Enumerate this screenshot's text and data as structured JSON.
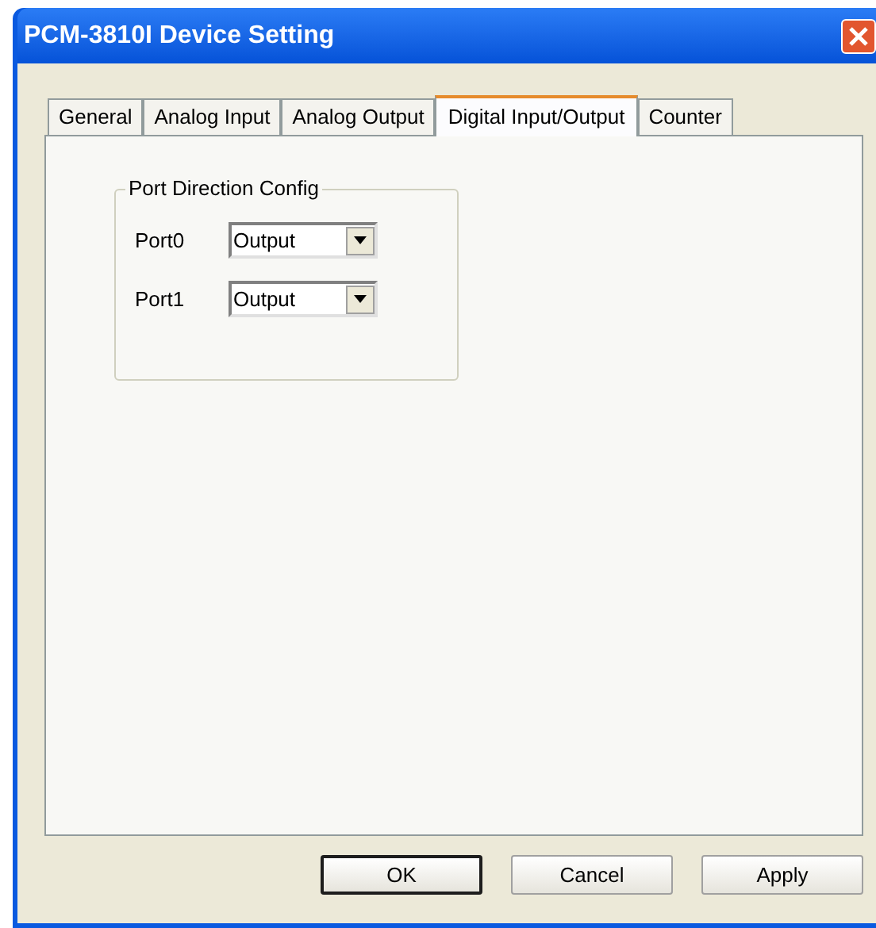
{
  "window": {
    "title": "PCM-3810I Device Setting"
  },
  "tabs": [
    {
      "label": "General",
      "selected": false
    },
    {
      "label": "Analog Input",
      "selected": false
    },
    {
      "label": "Analog Output",
      "selected": false
    },
    {
      "label": "Digital Input/Output",
      "selected": true
    },
    {
      "label": "Counter",
      "selected": false
    }
  ],
  "group": {
    "title": "Port Direction Config",
    "ports": [
      {
        "label": "Port0",
        "value": "Output"
      },
      {
        "label": "Port1",
        "value": "Output"
      }
    ]
  },
  "buttons": [
    {
      "label": "OK",
      "default": true
    },
    {
      "label": "Cancel",
      "default": false
    },
    {
      "label": "Apply",
      "default": false
    }
  ]
}
